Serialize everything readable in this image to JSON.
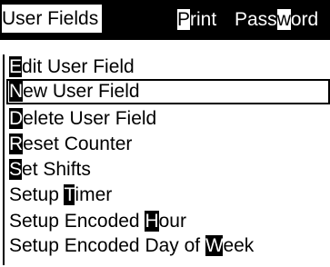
{
  "menubar": {
    "tabs": [
      {
        "mnemonic": "",
        "rest": "User Fields"
      },
      {
        "mnemonic": "P",
        "rest": "rint"
      },
      {
        "pre": "Pass",
        "mnemonic": "w",
        "rest": "ord"
      }
    ]
  },
  "menu": {
    "items": [
      {
        "pre": "",
        "mnemonic": "E",
        "rest": "dit User Field"
      },
      {
        "pre": "",
        "mnemonic": "N",
        "rest": "ew User Field",
        "selected": true
      },
      {
        "pre": "",
        "mnemonic": "D",
        "rest": "elete User Field"
      },
      {
        "pre": "",
        "mnemonic": "R",
        "rest": "eset Counter"
      },
      {
        "pre": "",
        "mnemonic": "S",
        "rest": "et Shifts"
      },
      {
        "pre": "Setup ",
        "mnemonic": "T",
        "rest": "imer"
      },
      {
        "pre": "Setup Encoded ",
        "mnemonic": "H",
        "rest": "our"
      },
      {
        "pre": "Setup Encoded Day of ",
        "mnemonic": "W",
        "rest": "eek"
      }
    ]
  }
}
